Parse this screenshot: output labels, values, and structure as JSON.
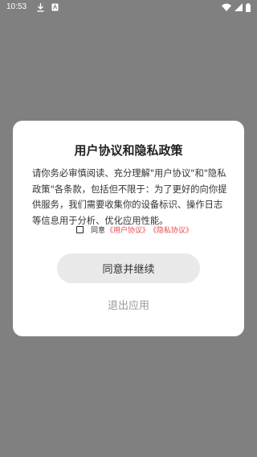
{
  "status_bar": {
    "time": "10:53",
    "icons": [
      "download-icon",
      "notification-icon",
      "wifi-icon",
      "signal-icon",
      "battery-icon"
    ]
  },
  "dialog": {
    "title": "用户协议和隐私政策",
    "body": "请你务必审慎阅读、充分理解\"用户协议\"和\"隐私政策\"各条款，包括但不限于：为了更好的向你提供服务，我们需要收集你的设备标识、操作日志等信息用于分析、优化应用性能。",
    "agree_label": "同意",
    "user_agreement_link": "《用户协议》",
    "privacy_policy_link": "《隐私协议》",
    "agree_button": "同意并继续",
    "exit_button": "退出应用"
  },
  "colors": {
    "overlay": "#808080",
    "dialog_bg": "#ffffff",
    "link": "#e5484d",
    "button_bg": "#e9e9e9",
    "secondary_text": "#9a9a9a"
  }
}
